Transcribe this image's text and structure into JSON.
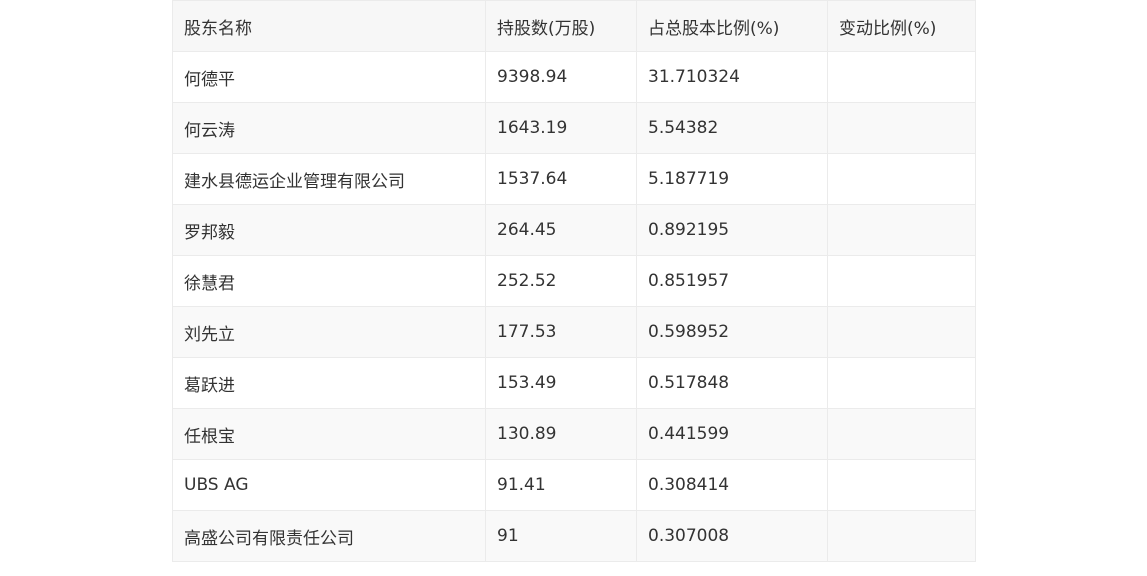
{
  "table": {
    "headers": [
      "股东名称",
      "持股数(万股)",
      "占总股本比例(%)",
      "变动比例(%)"
    ],
    "rows": [
      [
        "何德平",
        "9398.94",
        "31.710324",
        ""
      ],
      [
        "何云涛",
        "1643.19",
        "5.54382",
        ""
      ],
      [
        "建水县德运企业管理有限公司",
        "1537.64",
        "5.187719",
        ""
      ],
      [
        "罗邦毅",
        "264.45",
        "0.892195",
        ""
      ],
      [
        "徐慧君",
        "252.52",
        "0.851957",
        ""
      ],
      [
        "刘先立",
        "177.53",
        "0.598952",
        ""
      ],
      [
        "葛跃进",
        "153.49",
        "0.517848",
        ""
      ],
      [
        "任根宝",
        "130.89",
        "0.441599",
        ""
      ],
      [
        "UBS AG",
        "91.41",
        "0.308414",
        ""
      ],
      [
        "高盛公司有限责任公司",
        "91",
        "0.307008",
        ""
      ]
    ]
  }
}
